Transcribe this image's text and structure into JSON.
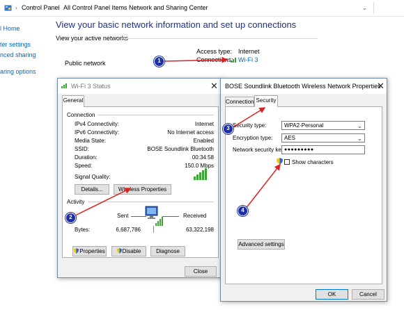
{
  "explorer": {
    "breadcrumb": [
      "Control Panel",
      "All Control Panel Items",
      "Network and Sharing Center"
    ],
    "sidebar": [
      "l Home",
      "ter settings",
      "nced sharing",
      "aring options"
    ],
    "heading": "View your basic network information and set up connections",
    "active_networks_label": "View your active networks",
    "network_name": "Public network",
    "access_type_label": "Access type:",
    "access_type_value": "Internet",
    "connections_label": "Connections:",
    "connections_value": "Wi-Fi 3"
  },
  "status_dialog": {
    "title": "Wi-Fi 3 Status",
    "tab": "General",
    "connection_label": "Connection",
    "rows": [
      {
        "label": "IPv4 Connectivity:",
        "value": "Internet"
      },
      {
        "label": "IPv6 Connectivity:",
        "value": "No Internet access"
      },
      {
        "label": "Media State:",
        "value": "Enabled"
      },
      {
        "label": "SSID:",
        "value": "BOSE Soundlink Bluetooth"
      },
      {
        "label": "Duration:",
        "value": "00:34:58"
      },
      {
        "label": "Speed:",
        "value": "150.0 Mbps"
      }
    ],
    "signal_quality_label": "Signal Quality:",
    "details_button": "Details...",
    "wireless_properties_button": "Wireless Properties",
    "activity_label": "Activity",
    "sent_label": "Sent",
    "received_label": "Received",
    "bytes_label": "Bytes:",
    "bytes_sent": "6,687,786",
    "bytes_received": "63,322,198",
    "properties_button": "Properties",
    "disable_button": "Disable",
    "diagnose_button": "Diagnose",
    "close_button": "Close"
  },
  "properties_dialog": {
    "title": "BOSE Soundlink Bluetooth Wireless Network Properties",
    "tab_connection": "Connection",
    "tab_security": "Security",
    "security_type_label": "Security type:",
    "security_type_value": "WPA2-Personal",
    "encryption_type_label": "Encryption type:",
    "encryption_type_value": "AES",
    "network_key_label": "Network security key",
    "network_key_value": "●●●●●●●●●",
    "show_characters_label": "Show characters",
    "advanced_settings_button": "Advanced settings",
    "ok_button": "OK",
    "cancel_button": "Cancel"
  },
  "annotations": [
    "1",
    "2",
    "3",
    "4"
  ],
  "colors": {
    "annotation": "#1e2fa6",
    "arrow": "#e02020",
    "link": "#0066cc",
    "heading": "#1e3287",
    "signal": "#3aa635"
  }
}
